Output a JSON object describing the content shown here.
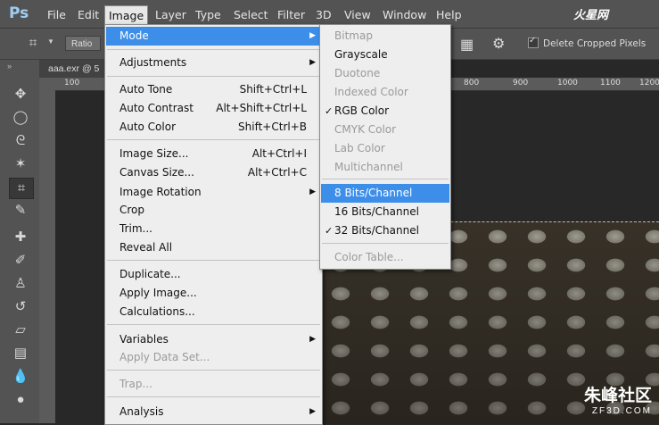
{
  "app": {
    "logo": "Ps",
    "menus": [
      "File",
      "Edit",
      "Image",
      "Layer",
      "Type",
      "Select",
      "Filter",
      "3D",
      "View",
      "Window",
      "Help"
    ],
    "active_menu": "Image",
    "watermark_top": "火星网"
  },
  "options_bar": {
    "ratio": "Ratio",
    "delete_cropped": "Delete Cropped Pixels",
    "delete_cropped_checked": true
  },
  "document": {
    "tab_title": "aaa.exr @ 5",
    "ruler_labels": [
      "100",
      "800",
      "900",
      "1000",
      "1100",
      "1200"
    ]
  },
  "image_menu": {
    "items": [
      {
        "label": "Mode",
        "submenu": true,
        "highlighted": true
      },
      {
        "label": "Adjustments",
        "submenu": true
      },
      {
        "label": "Auto Tone",
        "shortcut": "Shift+Ctrl+L"
      },
      {
        "label": "Auto Contrast",
        "shortcut": "Alt+Shift+Ctrl+L"
      },
      {
        "label": "Auto Color",
        "shortcut": "Shift+Ctrl+B"
      },
      {
        "label": "Image Size...",
        "shortcut": "Alt+Ctrl+I"
      },
      {
        "label": "Canvas Size...",
        "shortcut": "Alt+Ctrl+C"
      },
      {
        "label": "Image Rotation",
        "submenu": true
      },
      {
        "label": "Crop"
      },
      {
        "label": "Trim..."
      },
      {
        "label": "Reveal All"
      },
      {
        "label": "Duplicate..."
      },
      {
        "label": "Apply Image..."
      },
      {
        "label": "Calculations..."
      },
      {
        "label": "Variables",
        "submenu": true
      },
      {
        "label": "Apply Data Set...",
        "disabled": true
      },
      {
        "label": "Trap...",
        "disabled": true
      },
      {
        "label": "Analysis",
        "submenu": true
      }
    ]
  },
  "mode_menu": {
    "items": [
      {
        "label": "Bitmap",
        "disabled": true
      },
      {
        "label": "Grayscale"
      },
      {
        "label": "Duotone",
        "disabled": true
      },
      {
        "label": "Indexed Color",
        "disabled": true
      },
      {
        "label": "RGB Color",
        "checked": true
      },
      {
        "label": "CMYK Color",
        "disabled": true
      },
      {
        "label": "Lab Color",
        "disabled": true
      },
      {
        "label": "Multichannel",
        "disabled": true
      },
      {
        "label": "8 Bits/Channel",
        "highlighted": true
      },
      {
        "label": "16 Bits/Channel"
      },
      {
        "label": "32 Bits/Channel",
        "checked": true
      },
      {
        "label": "Color Table...",
        "disabled": true
      }
    ],
    "check_mark": "✓"
  },
  "watermark_bottom": {
    "line1": "朱峰社区",
    "line2": "ZF3D.COM"
  },
  "colors": {
    "highlight": "#3d8ee9",
    "menu_bg": "#eeeeee",
    "chrome": "#535353"
  }
}
